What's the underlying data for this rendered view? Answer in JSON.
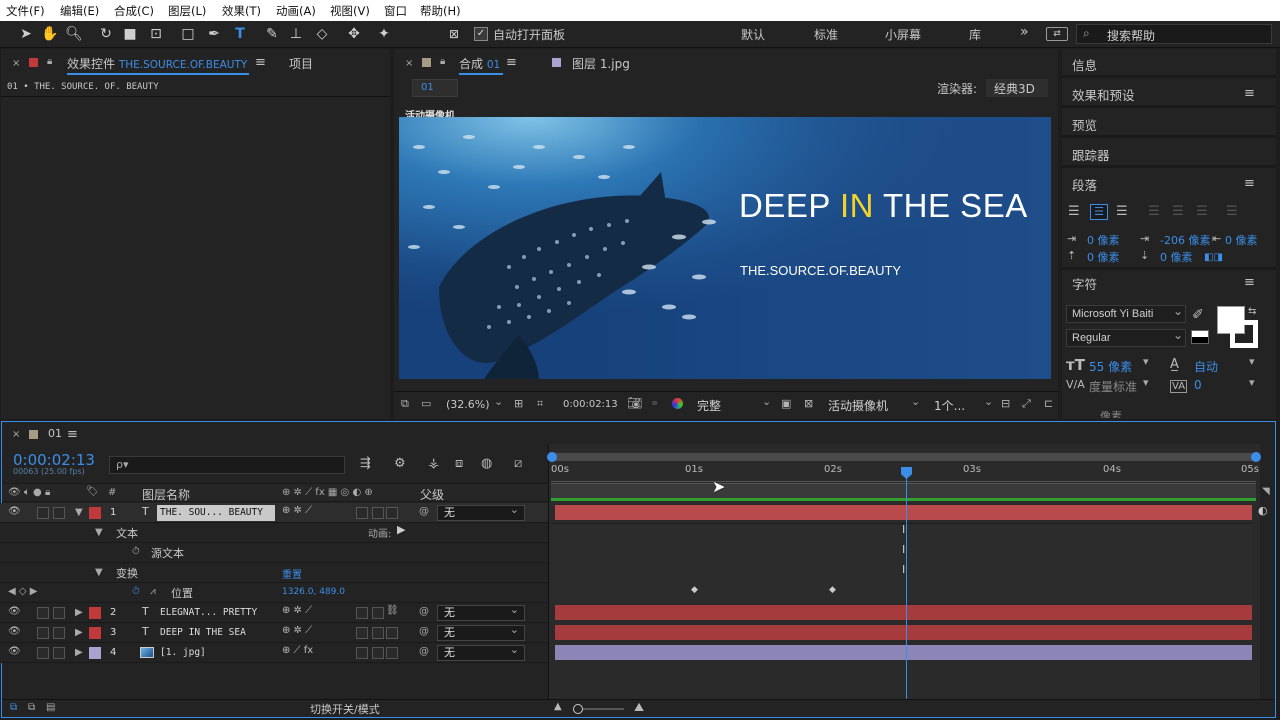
{
  "menu": [
    "文件(F)",
    "编辑(E)",
    "合成(C)",
    "图层(L)",
    "效果(T)",
    "动画(A)",
    "视图(V)",
    "窗口",
    "帮助(H)"
  ],
  "toolbar": {
    "auto_open_label": "自动打开面板",
    "workspaces": [
      "默认",
      "标准",
      "小屏幕",
      "库"
    ],
    "more": "»",
    "search_placeholder": "搜索帮助"
  },
  "effects_panel": {
    "tab_prefix": "效果控件",
    "tab_layer": "THE.SOURCE.OF.BEAUTY",
    "tab2": "项目",
    "breadcrumb": "01 • THE. SOURCE. OF. BEAUTY"
  },
  "comp_panel": {
    "tab_prefix": "合成",
    "tab_comp": "01",
    "tab2": "图层 1.jpg",
    "comp_chip": "01",
    "renderer_label": "渲染器:",
    "renderer_value": "经典3D",
    "camera_label": "活动摄像机",
    "title_prefix": "DEEP ",
    "title_accent": "IN",
    "title_suffix": " THE SEA",
    "subtitle": "THE.SOURCE.OF.BEAUTY",
    "zoom": "(32.6%)",
    "timecode": "0:00:02:13",
    "quality": "完整",
    "view": "活动摄像机",
    "views_count": "1个..."
  },
  "right_panel": {
    "items": [
      "信息",
      "效果和预设",
      "预览",
      "跟踪器",
      "段落"
    ],
    "para_fields": [
      {
        "value": "0 像素"
      },
      {
        "value": "-206 像素"
      },
      {
        "value": "0 像素"
      },
      {
        "value": "0 像素"
      },
      {
        "value": "0 像素"
      }
    ],
    "char_title": "字符",
    "font_family": "Microsoft Yi Baiti",
    "font_style": "Regular",
    "font_size": "55 像素",
    "leading": "自动",
    "kerning": "度量标准",
    "tracking": "0",
    "partial": "像素"
  },
  "timeline": {
    "comp_name": "01",
    "timecode": "0:00:02:13",
    "frames": "00063 (25.00 fps)",
    "search_placeholder": "ρ▾",
    "col_name": "图层名称",
    "col_parent": "父级",
    "ruler": [
      "00s",
      "01s",
      "02s",
      "03s",
      "04s",
      "05s"
    ],
    "layers": [
      {
        "num": "1",
        "name": "THE. SOU... BEAUTY",
        "parent": "无",
        "color": "#c0393b",
        "bar": "#b84a4b"
      },
      {
        "num": "2",
        "name": "ELEGNAT... PRETTY",
        "parent": "无",
        "color": "#c0393b",
        "bar": "#a53b3d"
      },
      {
        "num": "3",
        "name": "DEEP IN THE SEA",
        "parent": "无",
        "color": "#c0393b",
        "bar": "#a53b3d"
      },
      {
        "num": "4",
        "name": "[1. jpg]",
        "parent": "无",
        "color": "#a8a3cf",
        "bar": "#8c86b8"
      }
    ],
    "text_group": "文本",
    "animate_label": "动画:",
    "source_text": "源文本",
    "transform_group": "变换",
    "reset": "重置",
    "position_label": "位置",
    "position_value": "1326.0, 489.0",
    "bottom_label": "切换开关/模式"
  }
}
